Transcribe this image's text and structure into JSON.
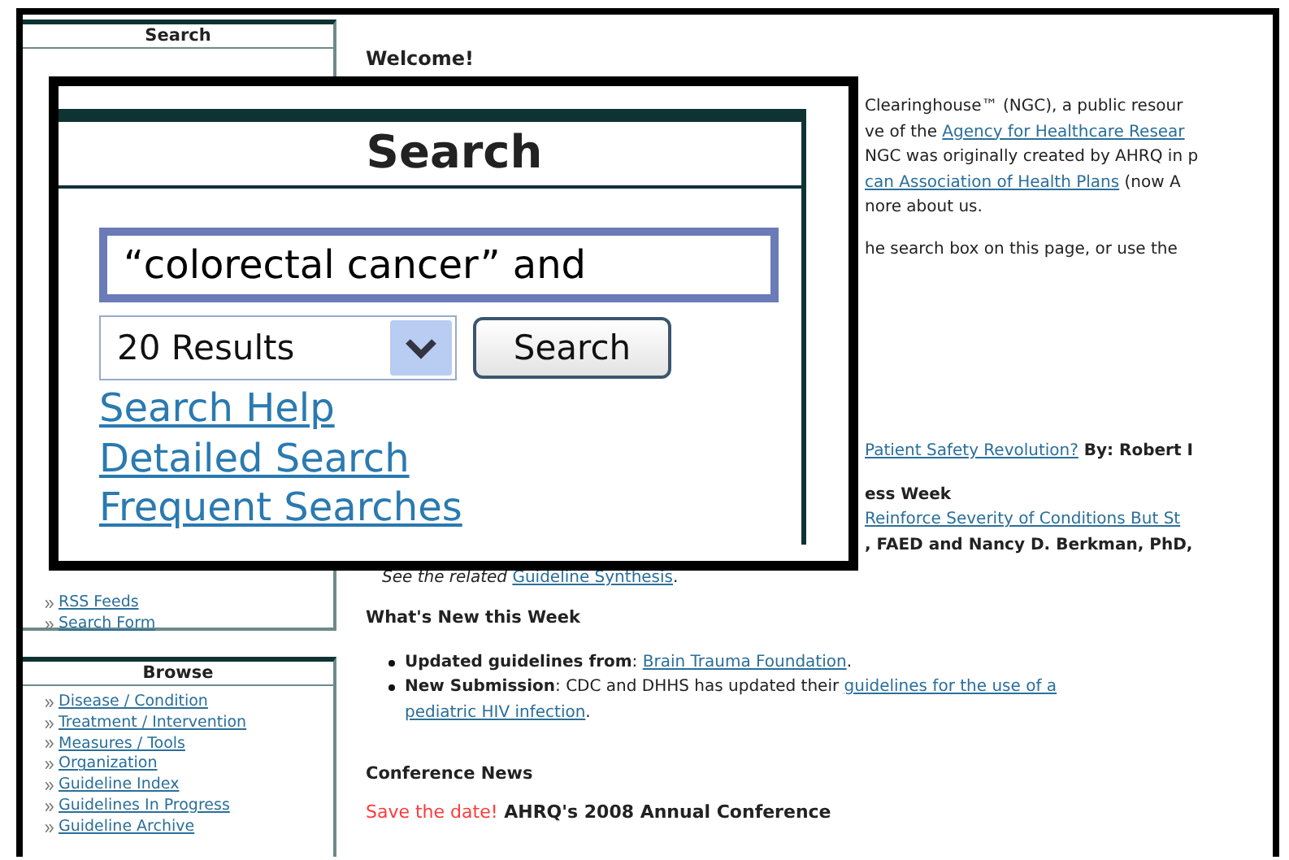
{
  "sidebar": {
    "search_panel": {
      "title": "Search",
      "links": [
        "RSS Feeds",
        "Search Form"
      ]
    },
    "browse_panel": {
      "title": "Browse",
      "links": [
        "Disease / Condition",
        "Treatment / Intervention",
        "Measures / Tools",
        "Organization",
        "Guideline Index",
        "Guidelines In Progress",
        "Guideline Archive"
      ]
    }
  },
  "main": {
    "heading": "Welcome!",
    "intro_lines": [
      [
        {
          "kind": "plain",
          "text": "Clearinghouse™ (NGC), a public resour"
        }
      ],
      [
        {
          "kind": "plain",
          "text": "ve of the "
        },
        {
          "kind": "link",
          "text": "Agency for Healthcare Resear"
        }
      ],
      [
        {
          "kind": "plain",
          "text": "NGC was originally created by AHRQ in p"
        }
      ],
      [
        {
          "kind": "link",
          "text": "can Association of Health Plans"
        },
        {
          "kind": "plain",
          "text": " (now A"
        }
      ],
      [
        {
          "kind": "plain",
          "text": "nore about us."
        }
      ],
      [
        {
          "kind": "plain",
          "text": "he search box on this page, or use the"
        }
      ]
    ],
    "news_lines": [
      [
        {
          "kind": "link",
          "text": "Patient Safety Revolution?"
        },
        {
          "kind": "bold",
          "text": " By: Robert I"
        }
      ],
      [
        {
          "kind": "bold",
          "text": "ess Week"
        }
      ],
      [
        {
          "kind": "link",
          "text": "Reinforce Severity of Conditions But St"
        }
      ],
      [
        {
          "kind": "bold",
          "text": ", FAED and Nancy D. Berkman, PhD,"
        }
      ]
    ],
    "synthesis_line": [
      {
        "kind": "italic",
        "text": "See the related "
      },
      {
        "kind": "link",
        "text": "Guideline Synthesis"
      },
      {
        "kind": "plain",
        "text": "."
      }
    ],
    "whats_new": {
      "title": "What's New this Week",
      "items": [
        [
          {
            "kind": "bold",
            "text": "Updated guidelines from"
          },
          {
            "kind": "plain",
            "text": ": "
          },
          {
            "kind": "link",
            "text": "Brain Trauma Foundation"
          },
          {
            "kind": "plain",
            "text": "."
          }
        ],
        [
          {
            "kind": "bold",
            "text": "New Submission"
          },
          {
            "kind": "plain",
            "text": ": CDC and DHHS has updated their "
          },
          {
            "kind": "link",
            "text": "guidelines for the use of a"
          },
          {
            "kind": "break"
          },
          {
            "kind": "link",
            "text": "pediatric HIV infection"
          },
          {
            "kind": "plain",
            "text": "."
          }
        ]
      ]
    },
    "conference": {
      "title": "Conference News",
      "line": [
        {
          "kind": "alert",
          "text": "Save the date!"
        },
        {
          "kind": "bold",
          "text": " AHRQ's 2008 Annual Conference"
        }
      ]
    }
  },
  "callout": {
    "title": "Search",
    "query": "“colorectal cancer” and",
    "results_option": "20 Results",
    "button": "Search",
    "links": [
      "Search Help",
      "Detailed Search",
      "Frequent Searches"
    ]
  }
}
